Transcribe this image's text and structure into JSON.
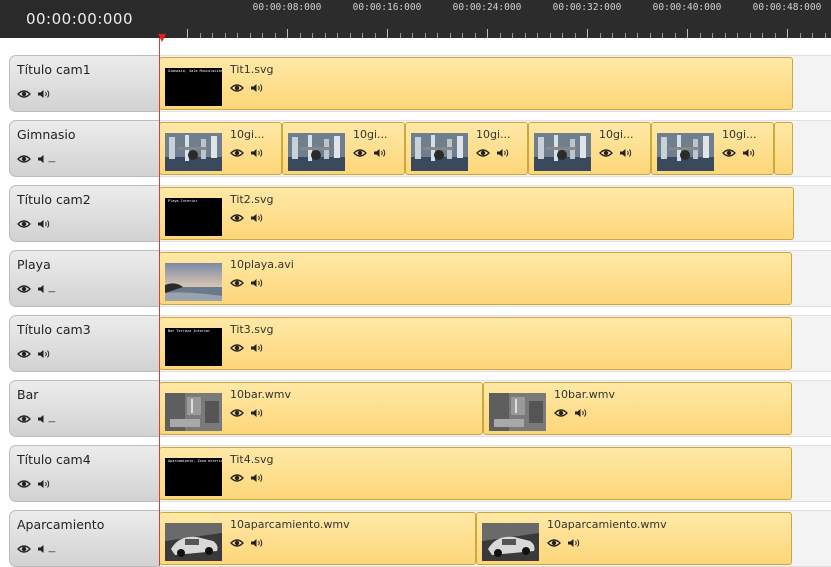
{
  "timecode": "00:00:00:000",
  "ruler": {
    "labels": [
      "00:00:08:000",
      "00:00:16:000",
      "00:00:24:000",
      "00:00:32:000",
      "00:00:40:000",
      "00:00:48:000"
    ]
  },
  "colors": {
    "clip_fill": "#fdd67a",
    "playhead": "#e02020",
    "header_bg": "#2a2a2a"
  },
  "tracks": [
    {
      "name": "Título cam1",
      "audio": "on",
      "clips": [
        {
          "name": "Tit1.svg",
          "thumb": "title",
          "thumb_text": "Gimnasio, Sala Musculación"
        }
      ]
    },
    {
      "name": "Gimnasio",
      "audio": "muted",
      "clips": [
        {
          "name": "10gi...",
          "thumb": "gym"
        },
        {
          "name": "10gi...",
          "thumb": "gym"
        },
        {
          "name": "10gi...",
          "thumb": "gym"
        },
        {
          "name": "10gi...",
          "thumb": "gym"
        },
        {
          "name": "10gi...",
          "thumb": "gym"
        },
        {
          "name": "",
          "thumb": "none"
        }
      ]
    },
    {
      "name": "Título cam2",
      "audio": "on",
      "clips": [
        {
          "name": "Tit2.svg",
          "thumb": "title",
          "thumb_text": "Playa Interior"
        }
      ]
    },
    {
      "name": "Playa",
      "audio": "muted",
      "clips": [
        {
          "name": "10playa.avi",
          "thumb": "beach"
        }
      ]
    },
    {
      "name": "Título cam3",
      "audio": "on",
      "clips": [
        {
          "name": "Tit3.svg",
          "thumb": "title",
          "thumb_text": "Bar Terraza Interior"
        }
      ]
    },
    {
      "name": "Bar",
      "audio": "muted",
      "clips": [
        {
          "name": "10bar.wmv",
          "thumb": "bar"
        },
        {
          "name": "10bar.wmv",
          "thumb": "bar"
        }
      ]
    },
    {
      "name": "Título cam4",
      "audio": "on",
      "clips": [
        {
          "name": "Tit4.svg",
          "thumb": "title",
          "thumb_text": "Aparcamiento, Zona exterior"
        }
      ]
    },
    {
      "name": "Aparcamiento",
      "audio": "muted",
      "clips": [
        {
          "name": "10aparcamiento.wmv",
          "thumb": "car"
        },
        {
          "name": "10aparcamiento.wmv",
          "thumb": "car"
        }
      ]
    }
  ]
}
